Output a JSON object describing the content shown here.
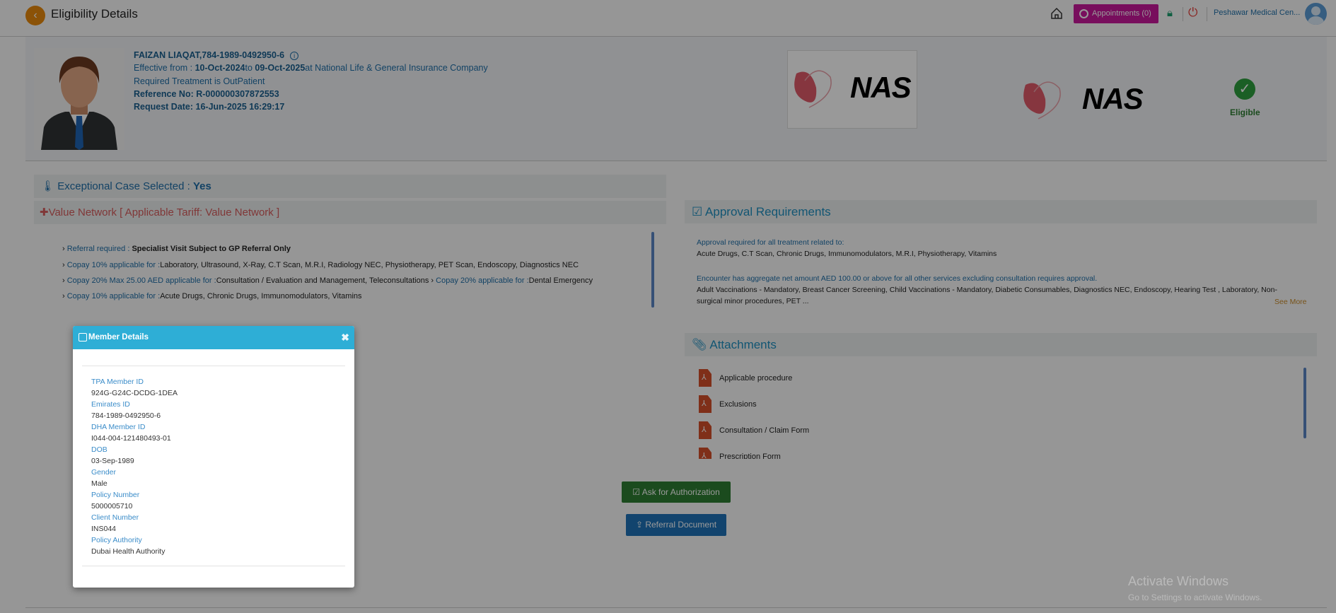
{
  "header": {
    "title": "Eligibility Details",
    "appointments_label": "Appointments (0)",
    "facility": "Peshawar Medical Cen..."
  },
  "member": {
    "name_id": "FAIZAN LIAQAT,784-1989-0492950-6",
    "effective_prefix": "Effective from : ",
    "effective_from": "10-Oct-2024",
    "to_word": "to ",
    "effective_to": "09-Oct-2025",
    "insurer": "at National Life & General Insurance Company",
    "treatment": "Required Treatment is OutPatient",
    "reference": "Reference No: R-000000307872553",
    "request_date": "Request Date: 16-Jun-2025 16:29:17",
    "logo_text": "NAS",
    "status": "Eligible"
  },
  "benefits": {
    "exceptional_label": "Exceptional Case Selected : ",
    "exceptional_value": "Yes",
    "network": "Value Network [ Applicable Tariff: Value Network ]",
    "items": [
      {
        "key": "Referral required :",
        "value": "Specialist Visit Subject to GP Referral Only"
      },
      {
        "key": "Copay 10% applicable for :",
        "value": "Laboratory, Ultrasound, X-Ray, C.T Scan, M.R.I, Radiology NEC, Physiotherapy, PET Scan, Endoscopy, Diagnostics NEC"
      },
      {
        "key": "Copay 20% Max 25.00 AED applicable for :",
        "value": "Consultation / Evaluation and Management, Teleconsultations",
        "key2": "Copay 20% applicable for :",
        "value2": "Dental Emergency"
      },
      {
        "key": "Copay 10% applicable for :",
        "value": "Acute Drugs, Chronic Drugs, Immunomodulators, Vitamins"
      }
    ]
  },
  "approval": {
    "title": "Approval Requirements",
    "heading1": "Approval required for all treatment related to:",
    "list1": "Acute Drugs, C.T Scan, Chronic Drugs, Immunomodulators, M.R.I, Physiotherapy, Vitamins",
    "heading2": "Encounter has aggregate net amount AED 100.00 or above for all other services excluding consultation requires approval.",
    "list2a": "Adult Vaccinations - Mandatory, Breast Cancer Screening, Child Vaccinations - Mandatory, Diabetic Consumables, Diagnostics NEC, Endoscopy, Hearing Test , Laboratory, Non-",
    "list2b": "surgical minor procedures, PET ...",
    "see_more": "See More"
  },
  "attachments": {
    "title": "Attachments",
    "items": [
      "Applicable procedure",
      "Exclusions",
      "Consultation / Claim Form",
      "Prescription Form"
    ]
  },
  "actions": {
    "ask_auth": "Ask for Authorization",
    "referral_doc": "Referral Document"
  },
  "modal": {
    "title": "Member Details",
    "fields": [
      {
        "label": "TPA Member ID",
        "value": "924G-G24C-DCDG-1DEA"
      },
      {
        "label": "Emirates ID",
        "value": "784-1989-0492950-6"
      },
      {
        "label": "DHA Member ID",
        "value": "I044-004-121480493-01"
      },
      {
        "label": "DOB",
        "value": "03-Sep-1989"
      },
      {
        "label": "Gender",
        "value": "Male"
      },
      {
        "label": "Policy Number",
        "value": "5000005710"
      },
      {
        "label": "Client Number",
        "value": "INS044"
      },
      {
        "label": "Policy Authority",
        "value": "Dubai Health Authority"
      }
    ]
  },
  "watermark": {
    "line1": "Activate Windows",
    "line2": "Go to Settings to activate Windows."
  }
}
